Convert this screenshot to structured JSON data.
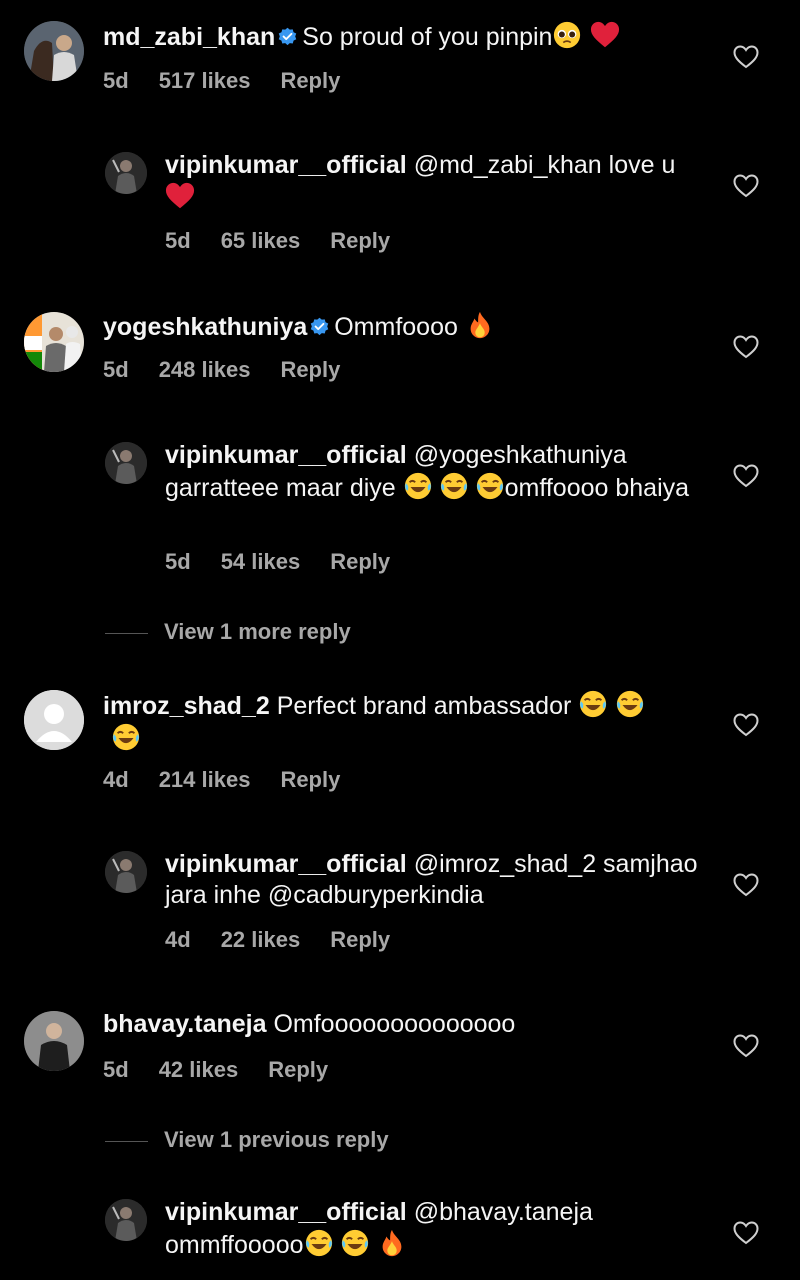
{
  "comments": [
    {
      "user": "md_zabi_khan",
      "verified": true,
      "text": "So proud of you pinpin",
      "emojis": [
        "pleading-face",
        "red-heart"
      ],
      "time": "5d",
      "likes": "517 likes",
      "reply": "Reply"
    },
    {
      "user": "vipinkumar__official",
      "text": "@md_zabi_khan love u",
      "emojis": [
        "red-heart"
      ],
      "time": "5d",
      "likes": "65 likes",
      "reply": "Reply"
    },
    {
      "user": "yogeshkathuniya",
      "verified": true,
      "text": "Ommfoooo",
      "emojis": [
        "fire"
      ],
      "time": "5d",
      "likes": "248 likes",
      "reply": "Reply"
    },
    {
      "user": "vipinkumar__official",
      "text_before": "@yogeshkathuniya garratteee maar diye",
      "text_after": "omffoooo bhaiya",
      "emojis": [
        "joy",
        "joy",
        "joy"
      ],
      "time": "5d",
      "likes": "54 likes",
      "reply": "Reply",
      "view_more": "View 1 more reply"
    },
    {
      "user": "imroz_shad_2",
      "text": "Perfect brand ambassador",
      "emojis": [
        "joy",
        "joy",
        "joy"
      ],
      "time": "4d",
      "likes": "214 likes",
      "reply": "Reply"
    },
    {
      "user": "vipinkumar__official",
      "text": "@imroz_shad_2 samjhao jara inhe @cadburyperkindia",
      "time": "4d",
      "likes": "22 likes",
      "reply": "Reply"
    },
    {
      "user": "bhavay.taneja",
      "text": "Omfoooooooooooooo",
      "time": "5d",
      "likes": "42 likes",
      "reply": "Reply",
      "view_previous": "View 1 previous reply"
    },
    {
      "user": "vipinkumar__official",
      "text": "@bhavay.taneja ommffooooo",
      "emojis": [
        "joy",
        "joy",
        "fire"
      ]
    }
  ],
  "icons": {
    "like": "heart-outline-icon",
    "verified": "verified-badge-icon"
  },
  "colors": {
    "background": "#000000",
    "text": "#f5f5f5",
    "meta": "#a8a8a8",
    "verified": "#3897f0"
  }
}
